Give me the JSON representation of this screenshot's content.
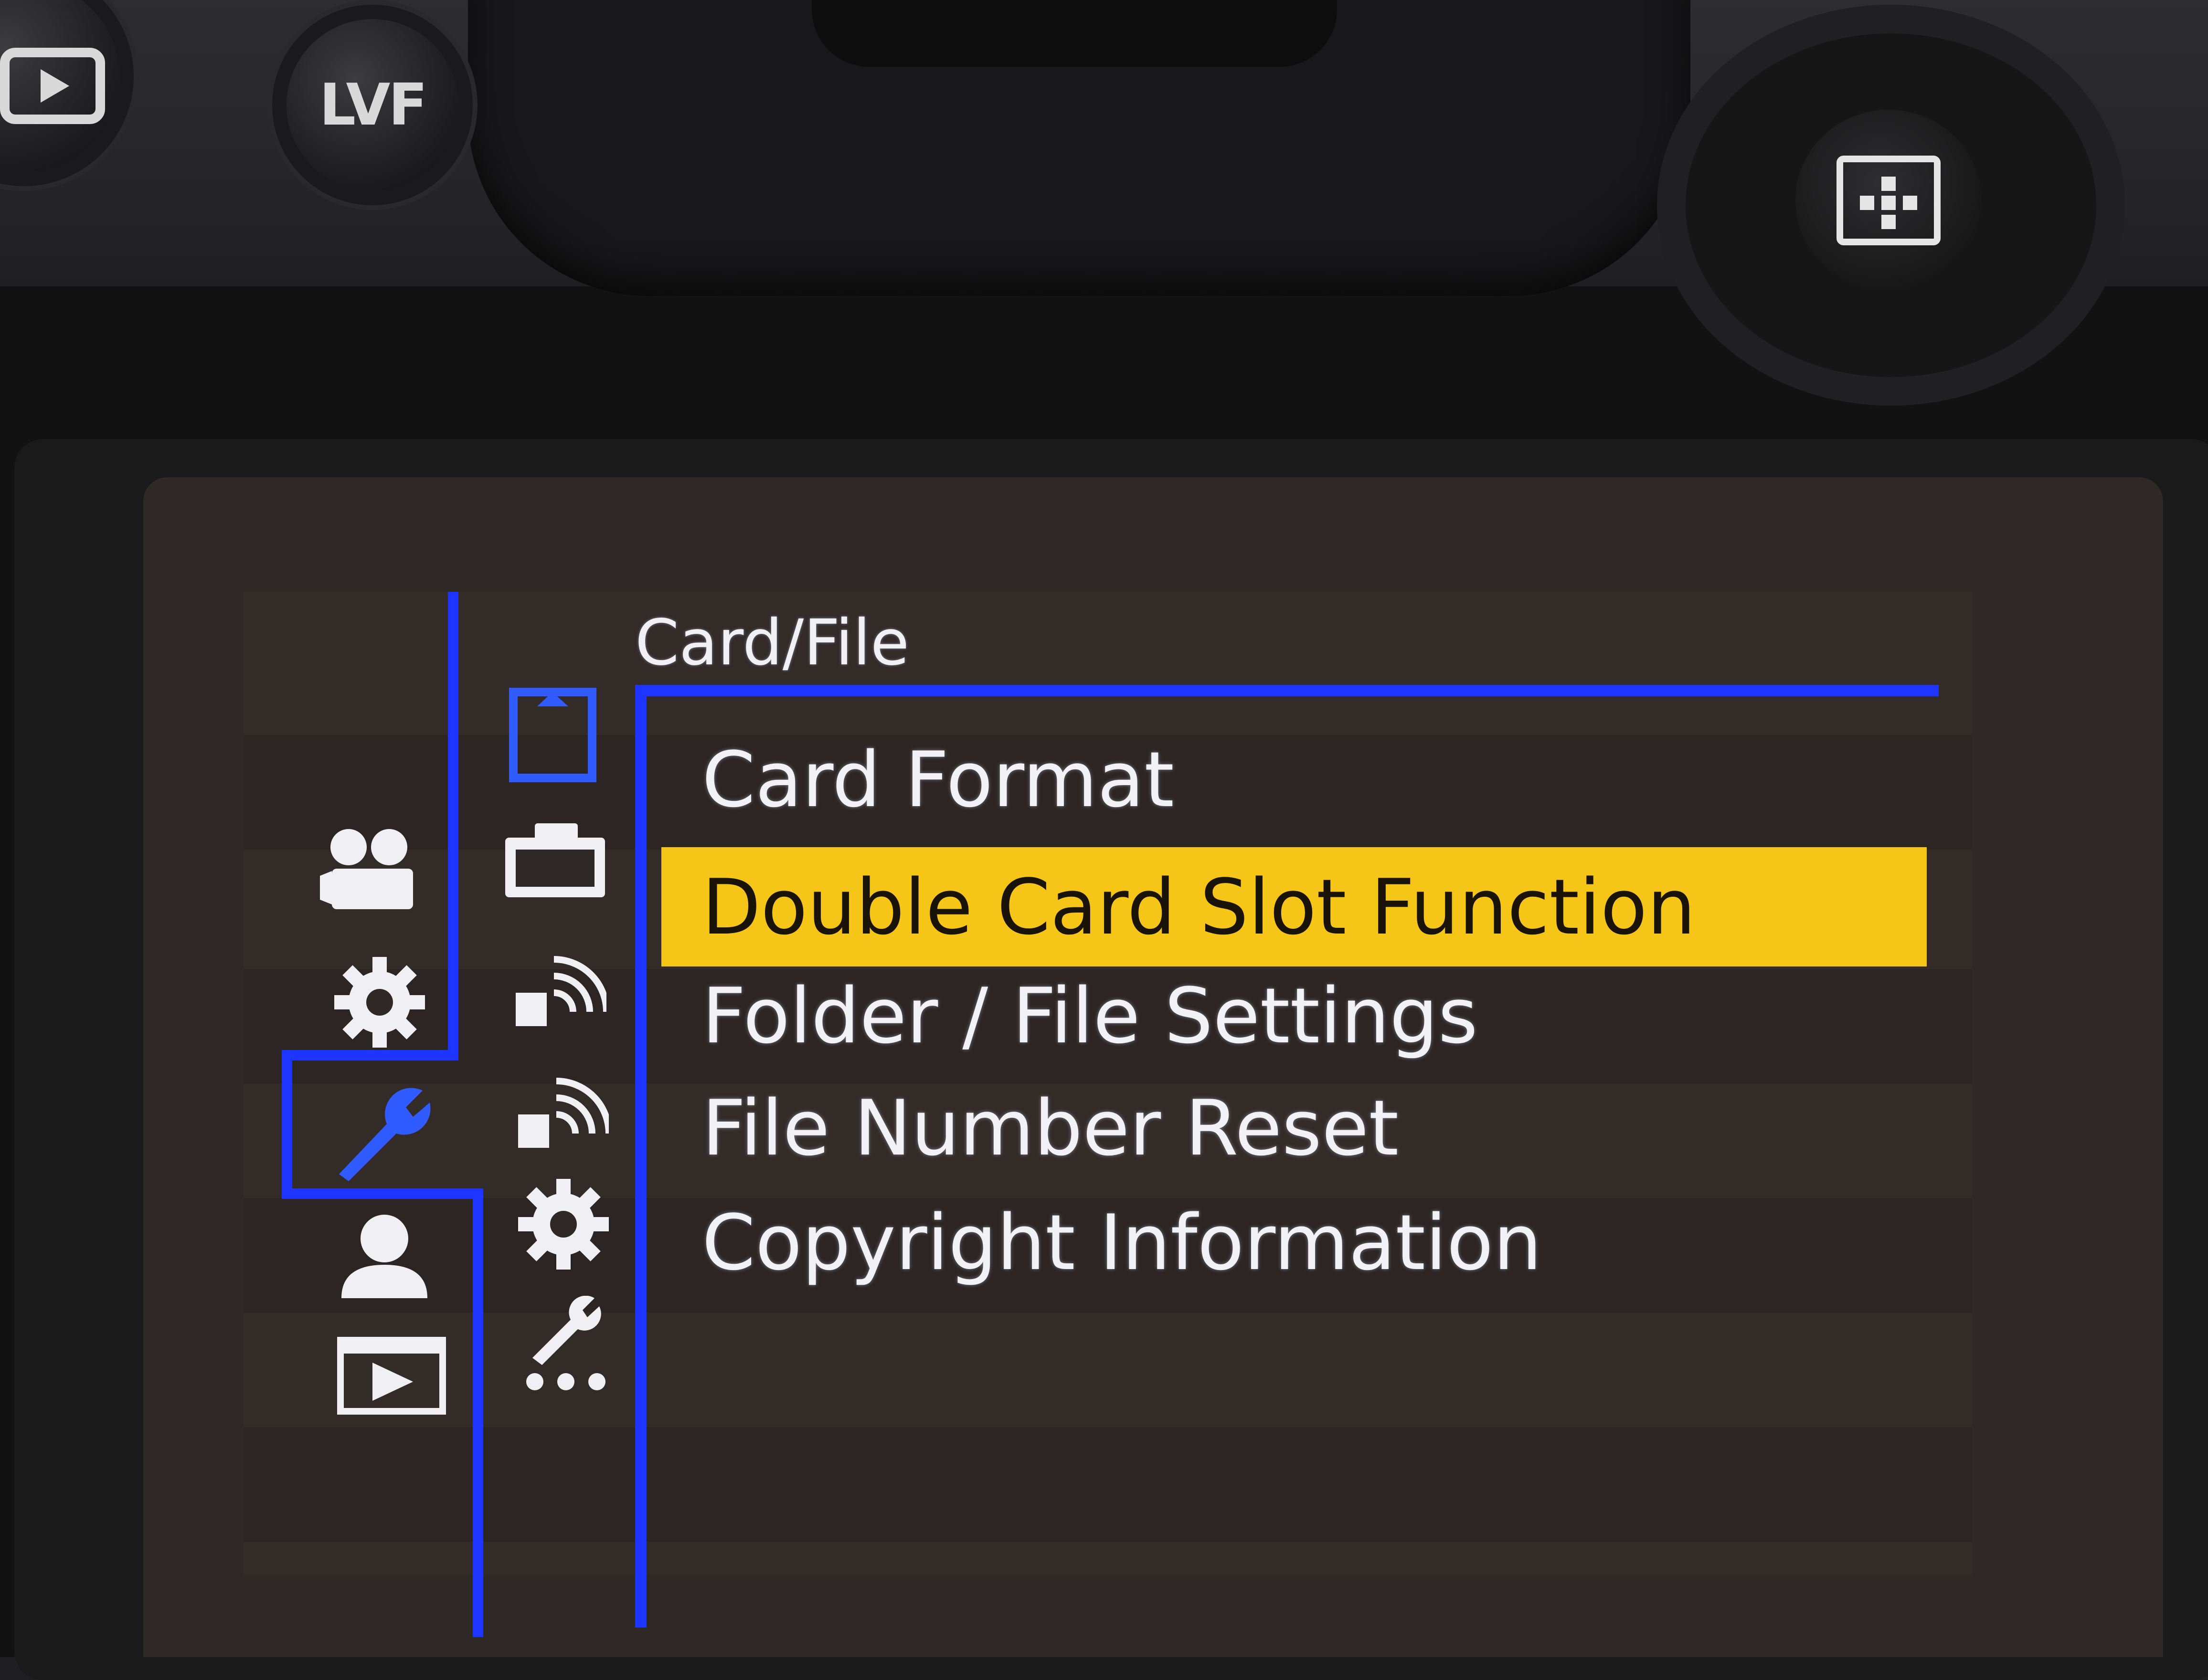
{
  "camera": {
    "playback_button_icon": "playback-icon",
    "lvf_button_label": "LVF",
    "joystick_icon": "joystick-grid-icon"
  },
  "menu": {
    "main_tabs": [
      {
        "icon": "video-camera-icon",
        "selected": false
      },
      {
        "icon": "gear-icon",
        "selected": false
      },
      {
        "icon": "wrench-icon",
        "selected": true
      },
      {
        "icon": "person-icon",
        "selected": false
      },
      {
        "icon": "playback-icon",
        "selected": false
      }
    ],
    "sub_tabs": [
      {
        "icon": "card-icon",
        "selected": true
      },
      {
        "icon": "monitor-icon",
        "selected": false
      },
      {
        "icon": "wireless-icon",
        "selected": false
      },
      {
        "icon": "wireless-icon",
        "selected": false
      },
      {
        "icon": "gear-icon",
        "selected": false
      },
      {
        "icon": "wrench-dots-icon",
        "selected": false
      }
    ],
    "section_title": "Card/File",
    "items": [
      {
        "label": "Card Format",
        "selected": false
      },
      {
        "label": "Double Card Slot Function",
        "selected": true
      },
      {
        "label": "Folder / File Settings",
        "selected": false
      },
      {
        "label": "File Number Reset",
        "selected": false
      },
      {
        "label": "Copyright Information",
        "selected": false
      }
    ],
    "colors": {
      "accent_blue": "#1e35ff",
      "highlight_yellow": "#f5c518",
      "background": "#2e2826",
      "text": "#f2f2f6"
    }
  }
}
